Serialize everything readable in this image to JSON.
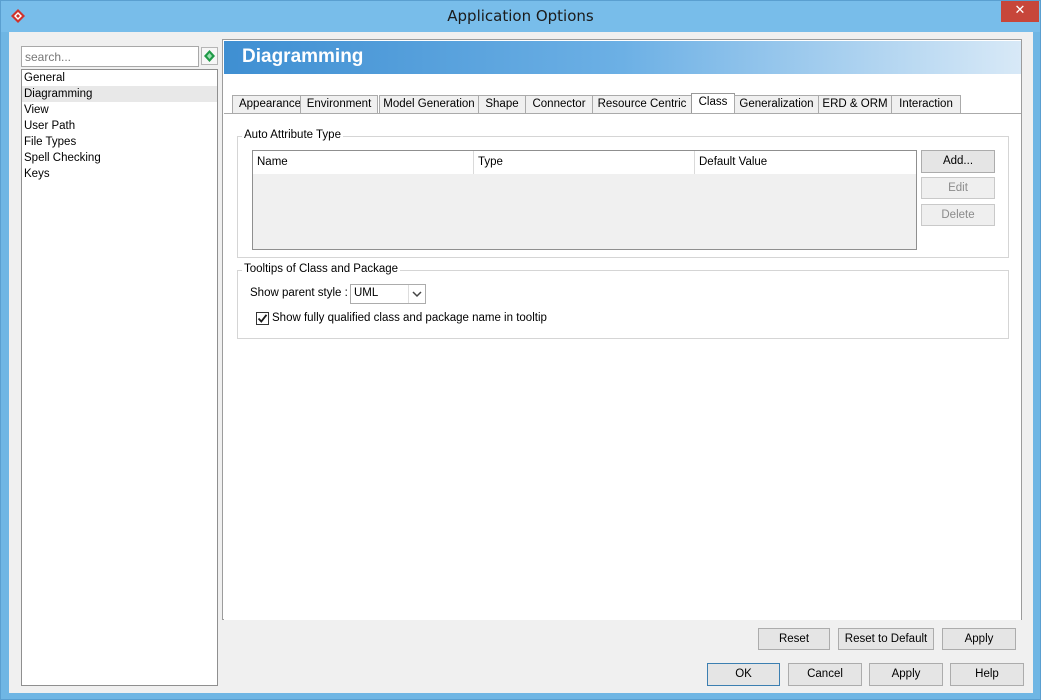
{
  "window": {
    "title": "Application Options",
    "close_glyph": "✕"
  },
  "search": {
    "placeholder": "search..."
  },
  "nav": {
    "items": [
      "General",
      "Diagramming",
      "View",
      "User Path",
      "File Types",
      "Spell Checking",
      "Keys"
    ],
    "selected": "Diagramming"
  },
  "header": {
    "title": "Diagramming"
  },
  "tabs": [
    {
      "label": "Appearance"
    },
    {
      "label": "Environment"
    },
    {
      "label": "Model Generation"
    },
    {
      "label": "Shape"
    },
    {
      "label": "Connector"
    },
    {
      "label": "Resource Centric"
    },
    {
      "label": "Class",
      "active": true
    },
    {
      "label": "Generalization"
    },
    {
      "label": "ERD & ORM"
    },
    {
      "label": "Interaction"
    }
  ],
  "auto_attr": {
    "legend": "Auto Attribute Type",
    "columns": [
      "Name",
      "Type",
      "Default Value"
    ],
    "add": "Add...",
    "edit": "Edit",
    "delete": "Delete"
  },
  "tooltips": {
    "legend": "Tooltips of Class and Package",
    "show_parent_label": "Show parent style :",
    "show_parent_value": "UML",
    "qualified_label": "Show fully qualified class and package name in tooltip",
    "qualified_checked": true
  },
  "panel_buttons": {
    "reset": "Reset",
    "reset_default": "Reset to Default",
    "apply": "Apply"
  },
  "dialog_buttons": {
    "ok": "OK",
    "cancel": "Cancel",
    "apply": "Apply",
    "help": "Help"
  },
  "colors": {
    "accent": "#3f8fd2",
    "title_bar": "#78bdea",
    "close": "#c7463a"
  },
  "icons": {
    "app": "vp-diamond-icon",
    "search_go": "green-diamond-icon",
    "combo": "chevron-down-icon",
    "check": "checkmark-icon"
  }
}
